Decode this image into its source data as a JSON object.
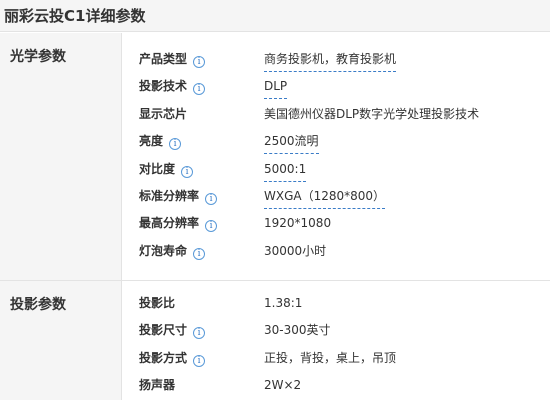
{
  "header": {
    "title": "丽彩云投C1详细参数"
  },
  "sections": [
    {
      "category": "光学参数",
      "rows": [
        {
          "label": "产品类型",
          "value": "商务投影机，教育投影机",
          "info": true,
          "link": true
        },
        {
          "label": "投影技术",
          "value": "DLP",
          "info": true,
          "link": true
        },
        {
          "label": "显示芯片",
          "value": "美国德州仪器DLP数字光学处理投影技术",
          "info": false,
          "link": false
        },
        {
          "label": "亮度",
          "value": "2500流明",
          "info": true,
          "link": true
        },
        {
          "label": "对比度",
          "value": "5000:1",
          "info": true,
          "link": true
        },
        {
          "label": "标准分辨率",
          "value": "WXGA（1280*800）",
          "info": true,
          "link": true
        },
        {
          "label": "最高分辨率",
          "value": "1920*1080",
          "info": true,
          "link": false
        },
        {
          "label": "灯泡寿命",
          "value": "30000小时",
          "info": true,
          "link": false
        }
      ]
    },
    {
      "category": "投影参数",
      "rows": [
        {
          "label": "投影比",
          "value": "1.38:1",
          "info": false,
          "link": false
        },
        {
          "label": "投影尺寸",
          "value": "30-300英寸",
          "info": true,
          "link": false
        },
        {
          "label": "投影方式",
          "value": "正投，背投，桌上，吊顶",
          "info": true,
          "link": false
        },
        {
          "label": "扬声器",
          "value": "2W×2",
          "info": false,
          "link": false
        }
      ]
    }
  ],
  "info_icon_glyph": "i",
  "colors": {
    "link_underline": "#3a7cc7",
    "info_icon": "#3a7cc7",
    "category_bg": "#f5f5f5",
    "border": "#e3e3e3"
  }
}
